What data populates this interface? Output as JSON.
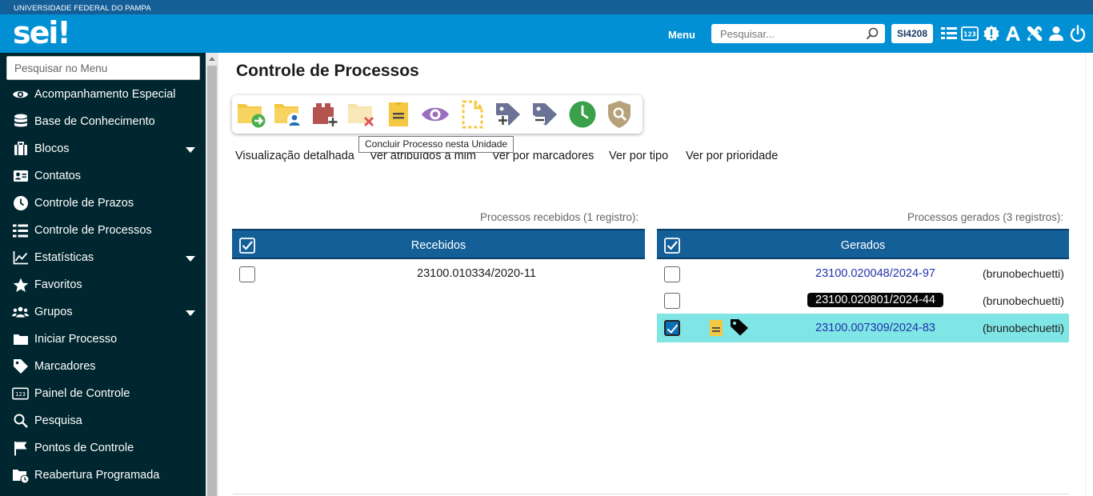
{
  "header": {
    "institution": "UNIVERSIDADE FEDERAL DO PAMPA",
    "logo_text": "sei",
    "logo_mark": "!",
    "menu_label": "Menu",
    "search_placeholder": "Pesquisar...",
    "unit": "SI4208",
    "icons": [
      "list-icon",
      "counter-123-icon",
      "alert-badge-icon",
      "font-a-icon",
      "tools-icon",
      "user-icon",
      "power-icon"
    ]
  },
  "sidebar": {
    "search_placeholder": "Pesquisar no Menu",
    "items": [
      {
        "label": "Acompanhamento Especial",
        "icon": "eye-icon"
      },
      {
        "label": "Base de Conhecimento",
        "icon": "database-icon"
      },
      {
        "label": "Blocos",
        "icon": "briefcase-icon"
      },
      {
        "label": "Contatos",
        "icon": "contact-card-icon"
      },
      {
        "label": "Controle de Prazos",
        "icon": "clock-icon"
      },
      {
        "label": "Controle de Processos",
        "icon": "list-icon"
      },
      {
        "label": "Estatísticas",
        "icon": "chart-line-icon"
      },
      {
        "label": "Favoritos",
        "icon": "star-icon"
      },
      {
        "label": "Grupos",
        "icon": "users-icon"
      },
      {
        "label": "Iniciar Processo",
        "icon": "folder-icon"
      },
      {
        "label": "Marcadores",
        "icon": "tag-icon"
      },
      {
        "label": "Painel de Controle",
        "icon": "counter-123-icon"
      },
      {
        "label": "Pesquisa",
        "icon": "search-icon"
      },
      {
        "label": "Pontos de Controle",
        "icon": "flag-icon"
      },
      {
        "label": "Reabertura Programada",
        "icon": "folder-clock-icon"
      }
    ]
  },
  "main": {
    "title": "Controle de Processos",
    "toolbar": {
      "buttons": [
        "send-folder-icon",
        "assign-folder-icon",
        "add-to-block-icon",
        "conclude-folder-icon",
        "annotation-icon",
        "eye-icon",
        "dashed-document-icon",
        "add-tag-icon",
        "remove-tag-icon",
        "deadline-clock-icon",
        "search-shield-icon"
      ],
      "tooltip": "Concluir Processo nesta Unidade"
    },
    "views": [
      "Visualização detalhada",
      "Ver atribuídos a mim",
      "Ver por marcadores",
      "Ver por tipo",
      "Ver por prioridade"
    ],
    "received": {
      "caption": "Processos recebidos (1 registro):",
      "header": "Recebidos",
      "rows": [
        {
          "process": "23100.010334/2020-11",
          "checked": false
        }
      ]
    },
    "generated": {
      "caption": "Processos gerados (3 registros):",
      "header": "Gerados",
      "rows": [
        {
          "process": "23100.020048/2024-97",
          "owner": "(brunobechuetti)",
          "checked": false,
          "style": "link"
        },
        {
          "process": "23100.020801/2024-44",
          "owner": "(brunobechuetti)",
          "checked": false,
          "style": "pill"
        },
        {
          "process": "23100.007309/2024-83",
          "owner": "(brunobechuetti)",
          "checked": true,
          "style": "link",
          "highlight_color": "#7fe5e5"
        }
      ]
    }
  },
  "colors": {
    "header_blue": "#0290d4",
    "top_band": "#155f99",
    "sidebar_bg": "#00262f",
    "table_header": "#155f99",
    "selected_row": "#7fe5e5",
    "link": "#2233aa"
  }
}
